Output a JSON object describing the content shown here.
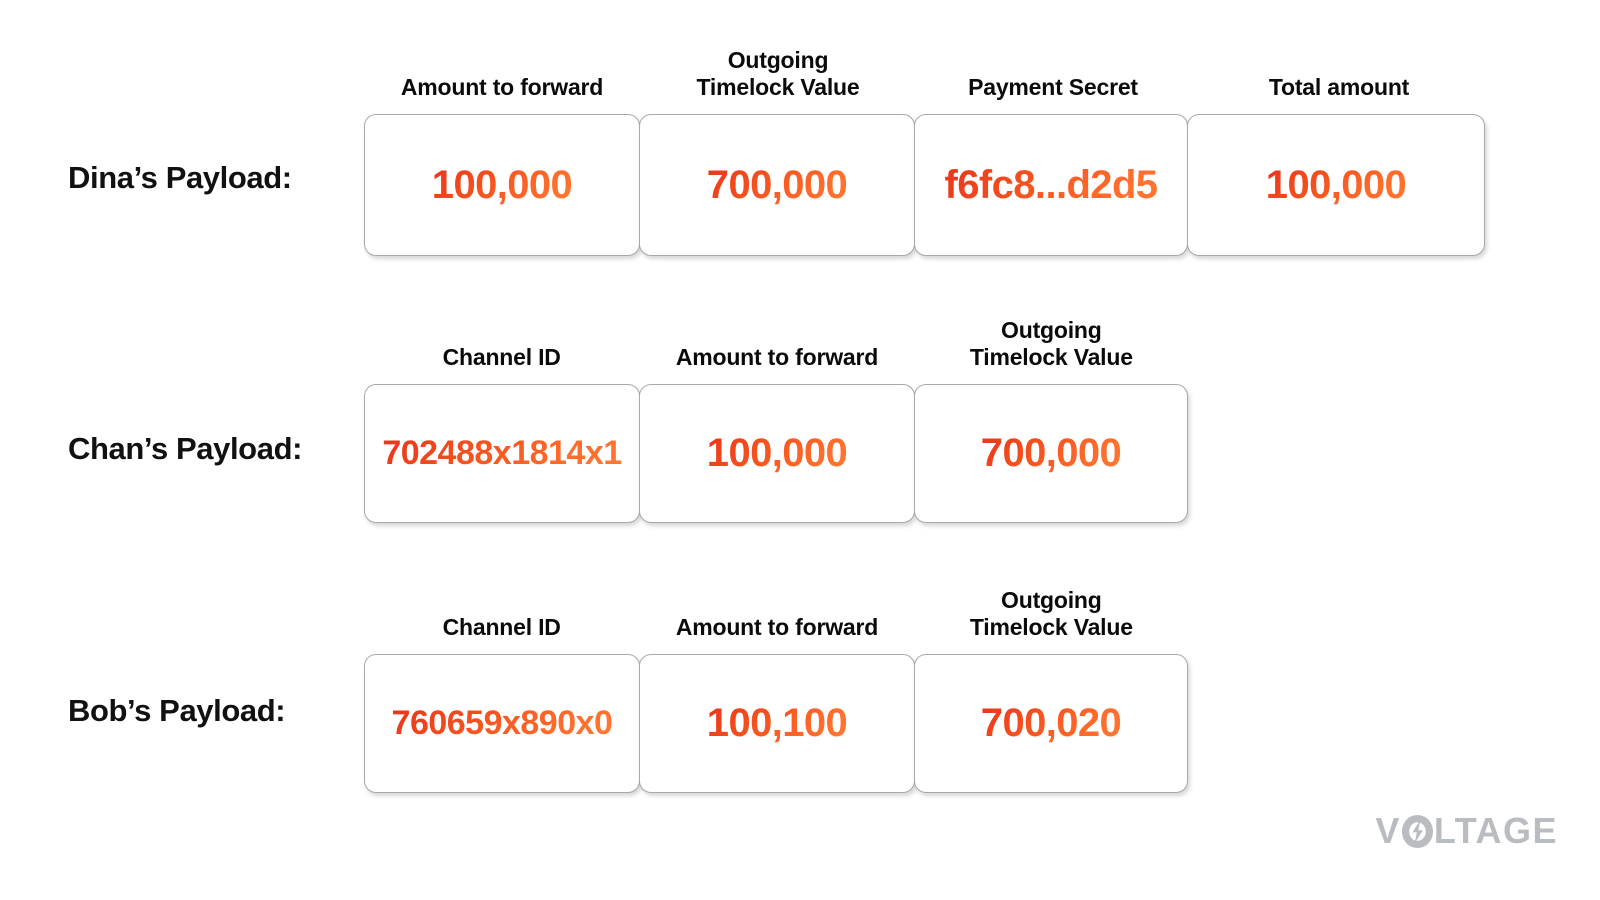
{
  "title": "Lightning Network Onion Payload Hops",
  "colors": {
    "value_orange": "#F4511E",
    "value_orange_dark": "#E8331C",
    "value_orange_light": "#FF7A33",
    "box_border": "#A9A9A9",
    "header_text": "#0B0B0B",
    "label_text": "#111111",
    "logo_grey": "#B9BCC0",
    "background": "#FFFFFF"
  },
  "rows": [
    {
      "label": "Dina’s Payload:",
      "headers": [
        "Amount to forward",
        "Outgoing\nTimelock Value",
        "Payment Secret",
        "Total amount"
      ],
      "headers_flat": [
        "Amount to forward",
        "Outgoing Timelock Value",
        "Payment Secret",
        "Total amount"
      ],
      "cells": [
        {
          "field": "Amount to forward",
          "value": "100,000"
        },
        {
          "field": "Outgoing Timelock Value",
          "value": "700,000"
        },
        {
          "field": "Payment Secret",
          "value": "f6fc8...d2d5"
        },
        {
          "field": "Total amount",
          "value": "100,000"
        }
      ]
    },
    {
      "label": "Chan’s Payload:",
      "headers": [
        "Channel ID",
        "Amount to forward",
        "Outgoing\nTimelock Value"
      ],
      "headers_flat": [
        "Channel ID",
        "Amount to forward",
        "Outgoing Timelock Value"
      ],
      "cells": [
        {
          "field": "Channel ID",
          "value": "702488x1814x1"
        },
        {
          "field": "Amount to forward",
          "value": "100,000"
        },
        {
          "field": "Outgoing Timelock Value",
          "value": "700,000"
        }
      ]
    },
    {
      "label": "Bob’s Payload:",
      "headers": [
        "Channel ID",
        "Amount to forward",
        "Outgoing\nTimelock Value"
      ],
      "headers_flat": [
        "Channel ID",
        "Amount to forward",
        "Outgoing Timelock Value"
      ],
      "cells": [
        {
          "field": "Channel ID",
          "value": "760659x890x0"
        },
        {
          "field": "Amount to forward",
          "value": "100,100"
        },
        {
          "field": "Outgoing Timelock Value",
          "value": "700,020"
        }
      ]
    }
  ],
  "logo": {
    "text_before": "V",
    "text_after": "LTAGE",
    "full_text": "VOLTAGE"
  }
}
